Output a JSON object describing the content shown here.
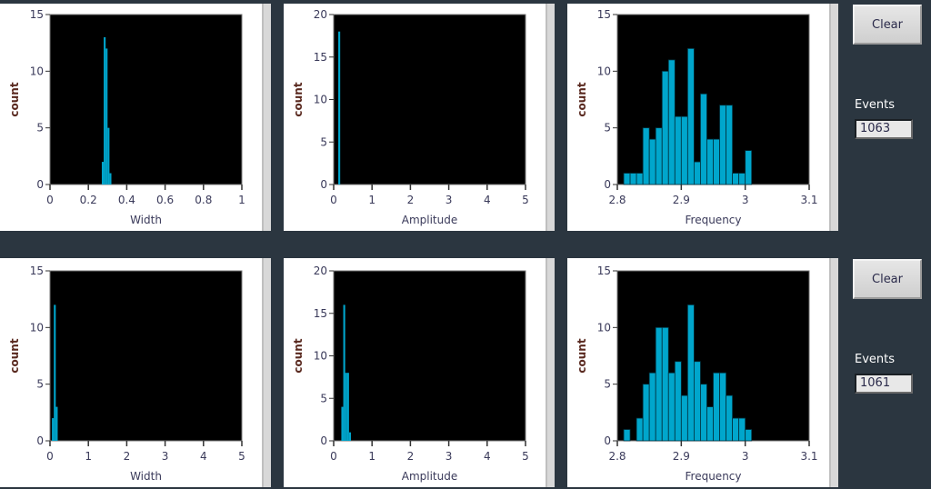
{
  "colors": {
    "bar": "#00a6cc",
    "plot_bg": "#000000",
    "page_bg": "#2b3640"
  },
  "rows": [
    {
      "clear_label": "Clear",
      "events_label": "Events",
      "events_value": "1063"
    },
    {
      "clear_label": "Clear",
      "events_label": "Events",
      "events_value": "1061"
    }
  ],
  "chart_data": [
    {
      "type": "bar",
      "title": "",
      "xlabel": "Width",
      "ylabel": "count",
      "xlim": [
        0,
        1
      ],
      "ylim": [
        0,
        15
      ],
      "xticks": [
        "0",
        "0.2",
        "0.4",
        "0.6",
        "0.8",
        "1"
      ],
      "xtick_values": [
        0,
        0.2,
        0.4,
        0.6,
        0.8,
        1
      ],
      "yticks": [
        "0",
        "5",
        "10",
        "15"
      ],
      "ytick_values": [
        0,
        5,
        10,
        15
      ],
      "bin_width": 0.01,
      "x": [
        0.27,
        0.28,
        0.29,
        0.3,
        0.31
      ],
      "values": [
        2,
        13,
        12,
        5,
        1
      ]
    },
    {
      "type": "bar",
      "title": "",
      "xlabel": "Amplitude",
      "ylabel": "count",
      "xlim": [
        0,
        5
      ],
      "ylim": [
        0,
        20
      ],
      "xticks": [
        "0",
        "1",
        "2",
        "3",
        "4",
        "5"
      ],
      "xtick_values": [
        0,
        1,
        2,
        3,
        4,
        5
      ],
      "yticks": [
        "0",
        "5",
        "10",
        "15",
        "20"
      ],
      "ytick_values": [
        0,
        5,
        10,
        15,
        20
      ],
      "bin_width": 0.05,
      "x": [
        0.12
      ],
      "values": [
        18
      ]
    },
    {
      "type": "bar",
      "title": "",
      "xlabel": "Frequency",
      "ylabel": "count",
      "xlim": [
        2.8,
        3.1
      ],
      "ylim": [
        0,
        15
      ],
      "xticks": [
        "2.8",
        "2.9",
        "3",
        "3.1"
      ],
      "xtick_values": [
        2.8,
        2.9,
        3.0,
        3.1
      ],
      "yticks": [
        "0",
        "5",
        "10",
        "15"
      ],
      "ytick_values": [
        0,
        5,
        10,
        15
      ],
      "bin_width": 0.01,
      "x": [
        2.81,
        2.82,
        2.83,
        2.84,
        2.85,
        2.86,
        2.87,
        2.88,
        2.89,
        2.9,
        2.91,
        2.92,
        2.93,
        2.94,
        2.95,
        2.96,
        2.97,
        2.98,
        2.99,
        3.0
      ],
      "values": [
        1,
        1,
        1,
        5,
        4,
        5,
        10,
        11,
        6,
        6,
        12,
        2,
        8,
        4,
        4,
        7,
        7,
        1,
        1,
        3
      ]
    },
    {
      "type": "bar",
      "title": "",
      "xlabel": "Width",
      "ylabel": "count",
      "xlim": [
        0,
        5
      ],
      "ylim": [
        0,
        15
      ],
      "xticks": [
        "0",
        "1",
        "2",
        "3",
        "4",
        "5"
      ],
      "xtick_values": [
        0,
        1,
        2,
        3,
        4,
        5
      ],
      "yticks": [
        "0",
        "5",
        "10",
        "15"
      ],
      "ytick_values": [
        0,
        5,
        10,
        15
      ],
      "bin_width": 0.05,
      "x": [
        0.05,
        0.1,
        0.15
      ],
      "values": [
        2,
        12,
        3
      ]
    },
    {
      "type": "bar",
      "title": "",
      "xlabel": "Amplitude",
      "ylabel": "count",
      "xlim": [
        0,
        5
      ],
      "ylim": [
        0,
        20
      ],
      "xticks": [
        "0",
        "1",
        "2",
        "3",
        "4",
        "5"
      ],
      "xtick_values": [
        0,
        1,
        2,
        3,
        4,
        5
      ],
      "yticks": [
        "0",
        "5",
        "10",
        "15",
        "20"
      ],
      "ytick_values": [
        0,
        5,
        10,
        15,
        20
      ],
      "bin_width": 0.05,
      "x": [
        0.2,
        0.25,
        0.3,
        0.35,
        0.4
      ],
      "values": [
        4,
        16,
        8,
        8,
        1
      ]
    },
    {
      "type": "bar",
      "title": "",
      "xlabel": "Frequency",
      "ylabel": "count",
      "xlim": [
        2.8,
        3.1
      ],
      "ylim": [
        0,
        15
      ],
      "xticks": [
        "2.8",
        "2.9",
        "3",
        "3.1"
      ],
      "xtick_values": [
        2.8,
        2.9,
        3.0,
        3.1
      ],
      "yticks": [
        "0",
        "5",
        "10",
        "15"
      ],
      "ytick_values": [
        0,
        5,
        10,
        15
      ],
      "bin_width": 0.01,
      "x": [
        2.81,
        2.82,
        2.83,
        2.84,
        2.85,
        2.86,
        2.87,
        2.88,
        2.89,
        2.9,
        2.91,
        2.92,
        2.93,
        2.94,
        2.95,
        2.96,
        2.97,
        2.98,
        2.99,
        3.0,
        3.01,
        3.02
      ],
      "values": [
        1,
        0,
        2,
        5,
        6,
        10,
        10,
        6,
        7,
        4,
        12,
        7,
        5,
        3,
        6,
        6,
        4,
        2,
        2,
        1,
        0,
        0
      ]
    }
  ]
}
